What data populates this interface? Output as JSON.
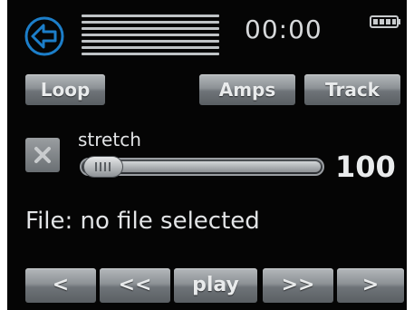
{
  "header": {
    "back_icon": "back-arrow-icon",
    "time": "00:00",
    "battery_icon": "battery-icon",
    "accent_color": "#1c7ec9"
  },
  "buttons": {
    "loop": "Loop",
    "amps": "Amps",
    "track": "Track"
  },
  "stretch": {
    "label": "stretch",
    "checkbox_icon": "x-icon",
    "value": "100"
  },
  "file": {
    "text": "File: no file selected"
  },
  "transport": {
    "prev": "<",
    "rewind": "<<",
    "play": "play",
    "forward": ">>",
    "next": ">"
  }
}
